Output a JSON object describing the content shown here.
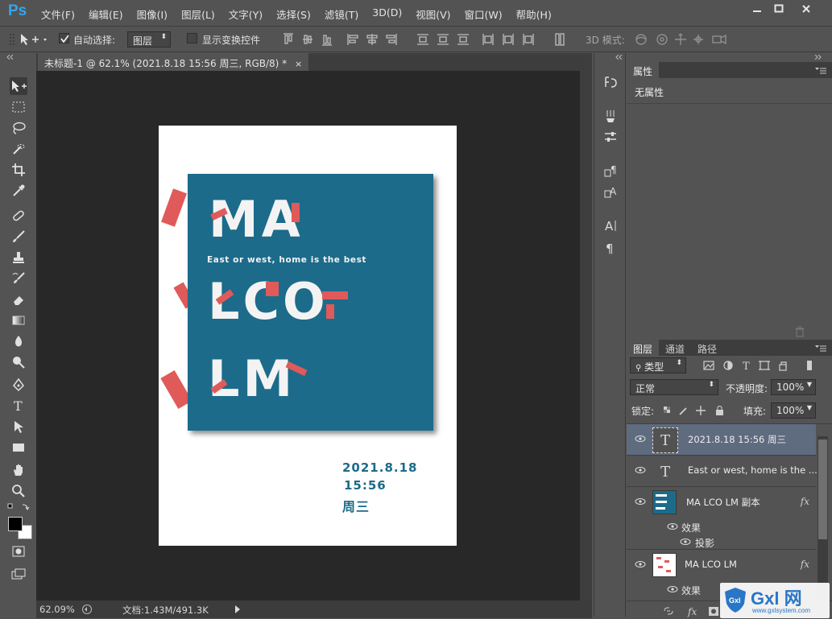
{
  "app": {
    "logo": "Ps",
    "menu": [
      "文件(F)",
      "编辑(E)",
      "图像(I)",
      "图层(L)",
      "文字(Y)",
      "选择(S)",
      "滤镜(T)",
      "3D(D)",
      "视图(V)",
      "窗口(W)",
      "帮助(H)"
    ]
  },
  "options": {
    "auto_select_label": "自动选择:",
    "auto_select_value": "图层",
    "show_transform_label": "显示变换控件",
    "mode_3d_label": "3D 模式:"
  },
  "document": {
    "tab_title": "未标题-1 @ 62.1% (2021.8.18 15:56 周三, RGB/8) *",
    "zoom": "62.09%",
    "doc_size": "文档:1.43M/491.3K"
  },
  "poster": {
    "line1": "MA",
    "line2": "LCO",
    "line3": "LM",
    "tagline": "East or west, home is the best",
    "date": "2021.8.18",
    "time": "15:56",
    "weekday": "周三",
    "teal_color": "#1c6b8a",
    "red_color": "#e05a5a"
  },
  "properties": {
    "tab": "属性",
    "content": "无属性"
  },
  "layers": {
    "tabs": [
      "图层",
      "通道",
      "路径"
    ],
    "filter_label": "类型",
    "blend_mode": "正常",
    "opacity_label": "不透明度:",
    "opacity_value": "100%",
    "lock_label": "锁定:",
    "fill_label": "填充:",
    "fill_value": "100%",
    "items": [
      {
        "name": "2021.8.18  15:56 周三",
        "thumb": "T"
      },
      {
        "name": "East or west, home is the ...",
        "thumb": "T"
      },
      {
        "name": "MA LCO LM 副本",
        "fx": "fx",
        "effects_label": "效果",
        "effect": "投影"
      },
      {
        "name": "MA LCO LM",
        "fx": "fx",
        "effects_label": "效果"
      }
    ]
  },
  "watermark": {
    "brand": "Gxl 网",
    "site": "www.gxlsystem.com"
  }
}
